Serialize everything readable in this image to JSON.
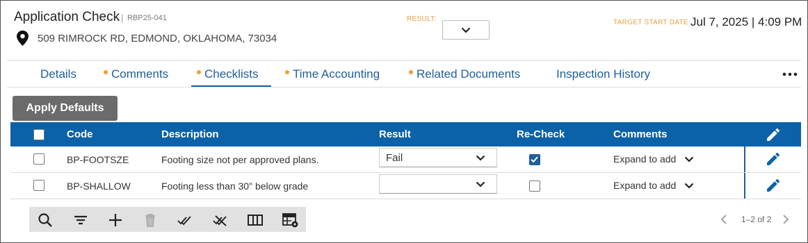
{
  "header": {
    "title": "Application Check",
    "separator": "|",
    "record_code": "RBP25-041",
    "address": "509 RIMROCK RD, EDMOND, OKLAHOMA, 73034",
    "result_label": "RESULT:",
    "result_value": "",
    "target_start_label": "TARGET START DATE:",
    "target_start_value": "Jul 7, 2025 | 4:09 PM"
  },
  "tabs": [
    {
      "label": "Details",
      "dot": false
    },
    {
      "label": "Comments",
      "dot": true
    },
    {
      "label": "Checklists",
      "dot": true,
      "active": true
    },
    {
      "label": "Time Accounting",
      "dot": true
    },
    {
      "label": "Related Documents",
      "dot": true
    },
    {
      "label": "Inspection History",
      "dot": false
    }
  ],
  "apply_defaults_label": "Apply Defaults",
  "table": {
    "columns": [
      "Code",
      "Description",
      "Result",
      "Re-Check",
      "Comments"
    ],
    "rows": [
      {
        "selected": false,
        "code": "BP-FOOTSZE",
        "description": "Footing size not per approved plans.",
        "result": "Fail",
        "recheck": true,
        "comments": "Expand to add"
      },
      {
        "selected": false,
        "code": "BP-SHALLOW",
        "description": "Footing less than 30\" below grade",
        "result": "",
        "recheck": false,
        "comments": "Expand to add"
      }
    ]
  },
  "toolbar_icons": [
    "search-icon",
    "filter-icon",
    "add-icon",
    "delete-icon",
    "check-all-icon",
    "uncheck-all-icon",
    "columns-icon",
    "table-settings-icon"
  ],
  "pager": {
    "text": "1–2 of 2"
  },
  "colors": {
    "accent": "#0b62a8",
    "tab_text": "#1f5e9a",
    "dot": "#f0a030",
    "label_orange": "#e8a03c"
  }
}
